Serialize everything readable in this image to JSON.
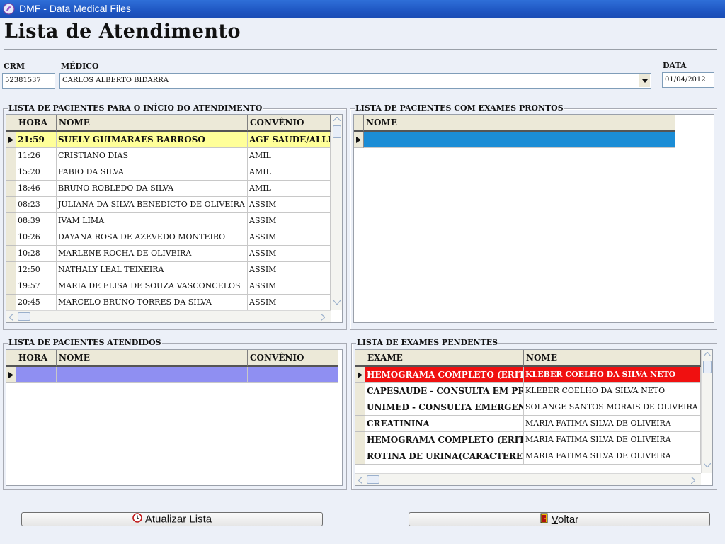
{
  "window": {
    "title": "DMF - Data Medical Files"
  },
  "page": {
    "title": "Lista de Atendimento"
  },
  "form": {
    "crm_label": "CRM",
    "crm_value": "52381537",
    "medico_label": "MÉDICO",
    "medico_value": "CARLOS ALBERTO BIDARRA",
    "data_label": "DATA",
    "data_value": "01/04/2012"
  },
  "panel_inicio": {
    "title": "LISTA DE PACIENTES PARA O INÍCIO DO ATENDIMENTO",
    "columns": [
      "HORA",
      "NOME",
      "CONVÊNIO"
    ],
    "rows": [
      [
        "21:59",
        "SUELY GUIMARAES BARROSO",
        "AGF SAUDE/ALLI"
      ],
      [
        "11:26",
        "CRISTIANO DIAS",
        "AMIL"
      ],
      [
        "15:20",
        "FABIO DA SILVA",
        "AMIL"
      ],
      [
        "18:46",
        "BRUNO ROBLEDO DA SILVA",
        "AMIL"
      ],
      [
        "08:23",
        "JULIANA DA SILVA BENEDICTO DE OLIVEIRA",
        "ASSIM"
      ],
      [
        "08:39",
        "IVAM LIMA",
        "ASSIM"
      ],
      [
        "10:26",
        "DAYANA ROSA DE AZEVEDO MONTEIRO",
        "ASSIM"
      ],
      [
        "10:28",
        "MARLENE ROCHA DE OLIVEIRA",
        "ASSIM"
      ],
      [
        "12:50",
        "NATHALY LEAL TEIXEIRA",
        "ASSIM"
      ],
      [
        "19:57",
        "MARIA DE ELISA DE SOUZA VASCONCELOS",
        "ASSIM"
      ],
      [
        "20:45",
        "MARCELO BRUNO TORRES DA SILVA",
        "ASSIM"
      ]
    ]
  },
  "panel_prontos": {
    "title": "LISTA DE PACIENTES COM EXAMES PRONTOS",
    "columns": [
      "NOME"
    ]
  },
  "panel_atendidos": {
    "title": "LISTA DE PACIENTES ATENDIDOS",
    "columns": [
      "HORA",
      "NOME",
      "CONVÊNIO"
    ]
  },
  "panel_pendentes": {
    "title": "LISTA DE EXAMES PENDENTES",
    "columns": [
      "EXAME",
      "NOME"
    ],
    "rows": [
      [
        "HEMOGRAMA COMPLETO (ERITR",
        "KLEBER COELHO DA SILVA NETO"
      ],
      [
        "CAPESAUDE - CONSULTA EM PRO",
        "KLEBER COELHO DA SILVA NETO"
      ],
      [
        "UNIMED - CONSULTA EMERGENC",
        "SOLANGE SANTOS MORAIS DE OLIVEIRA"
      ],
      [
        "CREATININA",
        "MARIA FATIMA SILVA DE OLIVEIRA"
      ],
      [
        "HEMOGRAMA COMPLETO (ERITR",
        "MARIA FATIMA SILVA DE OLIVEIRA"
      ],
      [
        "ROTINA DE URINA(CARACTERES",
        "MARIA FATIMA SILVA DE OLIVEIRA"
      ]
    ]
  },
  "buttons": {
    "atualizar_prefix": "A",
    "atualizar_rest": "tualizar Lista",
    "voltar_prefix": "V",
    "voltar_rest": "oltar"
  },
  "colors": {
    "selected_row": "#FFFF99",
    "selected_blue": "#1B8DD6",
    "selected_lavender": "#8F8FF2",
    "selected_red": "#F01010"
  },
  "icons": {
    "app": "dmf-app-icon",
    "atualizar": "clock-icon",
    "voltar": "exit-door-icon",
    "row_pointer": "row-pointer-icon"
  }
}
